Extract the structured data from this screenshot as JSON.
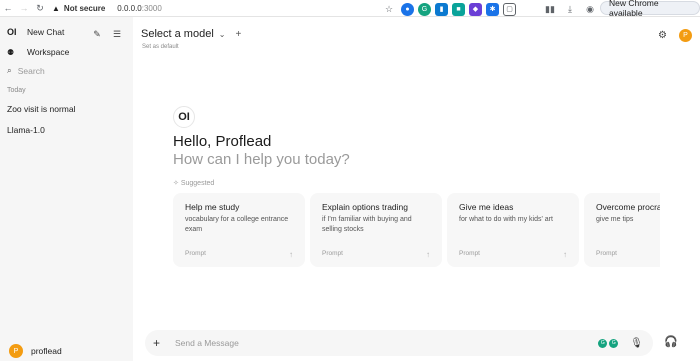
{
  "browser": {
    "warning": "Not secure",
    "url_host": "0.0.0.0",
    "url_port": ":3000",
    "update_button": "New Chrome available",
    "extensions": [
      {
        "icon": "blue-circle-ext-icon",
        "color": "#1a73e8",
        "glyph": "●"
      },
      {
        "icon": "grammarly-ext-icon",
        "color": "#15a37f",
        "glyph": "G"
      },
      {
        "icon": "trello-ext-icon",
        "color": "#0b79d0",
        "glyph": "▮"
      },
      {
        "icon": "teal-square-ext-icon",
        "color": "#0aa39a",
        "glyph": "■"
      },
      {
        "icon": "purple-ext-icon",
        "color": "#6b3fd6",
        "glyph": "◆"
      },
      {
        "icon": "puzzle-ext-icon",
        "color": "#1a73e8",
        "glyph": "✱"
      },
      {
        "icon": "screenshot-ext-icon",
        "color": "#5f6368",
        "glyph": "▢"
      }
    ]
  },
  "sidebar": {
    "brand": "OI",
    "new_chat": "New Chat",
    "workspace": "Workspace",
    "search_placeholder": "Search",
    "section": "Today",
    "chats": [
      "Zoo visit is normal",
      "Llama-1.0"
    ],
    "user": {
      "initial": "P",
      "name": "proflead"
    }
  },
  "main": {
    "model_select": "Select a model",
    "set_default": "Set as default",
    "avatar_initial": "P",
    "logo": "OI",
    "greeting": "Hello, Proflead",
    "subgreeting": "How can I help you today?",
    "suggested_label": "Suggested",
    "cards": [
      {
        "title": "Help me study",
        "desc": "vocabulary for a college entrance exam",
        "prompt": "Prompt"
      },
      {
        "title": "Explain options trading",
        "desc": "if I'm familiar with buying and selling stocks",
        "prompt": "Prompt"
      },
      {
        "title": "Give me ideas",
        "desc": "for what to do with my kids' art",
        "prompt": "Prompt"
      },
      {
        "title": "Overcome procrastination",
        "desc": "give me tips",
        "prompt": "Prompt"
      }
    ],
    "composer_placeholder": "Send a Message"
  }
}
